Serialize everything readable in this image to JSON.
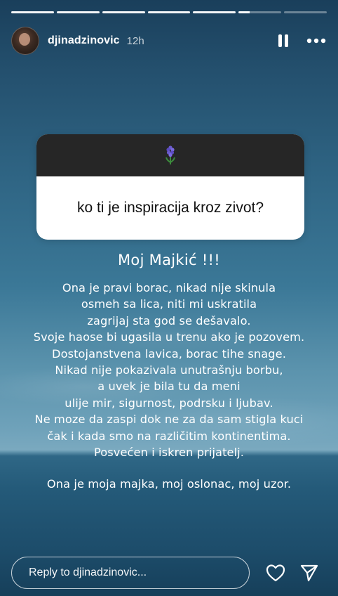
{
  "progress": {
    "segments_total": 7,
    "segments_completed": 5,
    "current_fraction": 0.25
  },
  "header": {
    "username": "djinadzinovic",
    "time": "12h"
  },
  "question_box": {
    "emoji": "🪻",
    "question": "ko ti je inspiracija kroz zivot?"
  },
  "story": {
    "title": "Moj Majkić !!!",
    "lines": [
      "Ona je pravi borac, nikad nije skinula",
      "osmeh sa lica, niti mi uskratila",
      "zagrijaj sta god se dešavalo.",
      "Svoje haose bi ugasila u trenu ako je pozovem.",
      "Dostojanstvena lavica, borac tihe snage.",
      "Nikad nije pokazivala unutrašnju borbu,",
      "a uvek je bila tu da meni",
      "ulije mir, sigurnost, podrsku i ljubav.",
      "Ne moze da zaspi dok ne za da sam stigla kuci",
      "čak i kada smo na različitim kontinentima.",
      "Posvećen i iskren prijatelj."
    ],
    "closing": "Ona je moja majka, moj oslonac, moj uzor."
  },
  "reply": {
    "placeholder": "Reply to djinadzinovic..."
  },
  "icons": {
    "pause": "pause-icon",
    "more": "more-horizontal-icon",
    "like": "heart-icon",
    "send": "send-icon"
  }
}
